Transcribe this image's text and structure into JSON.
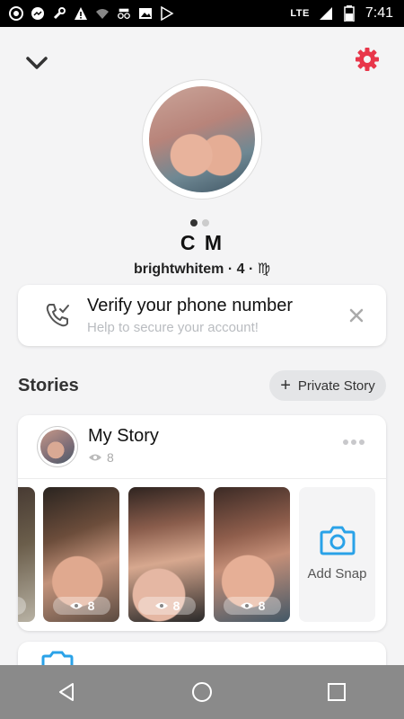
{
  "status_bar": {
    "network": "LTE",
    "time": "7:41"
  },
  "profile": {
    "display_name": "C M",
    "meta": "brightwhitem · 4 · ♍"
  },
  "verify_card": {
    "title": "Verify your phone number",
    "subtitle": "Help to secure your account!"
  },
  "stories": {
    "title": "Stories",
    "private_story_label": "Private Story",
    "my_story": {
      "name": "My Story",
      "views": "8"
    },
    "snaps": [
      {
        "views": "8"
      },
      {
        "views": "8"
      },
      {
        "views": "8"
      },
      {
        "views": "8"
      }
    ],
    "add_snap_label": "Add Snap"
  },
  "colors": {
    "accent_red": "#e8364a",
    "accent_blue": "#2aa2e8",
    "background": "#f4f4f5"
  }
}
